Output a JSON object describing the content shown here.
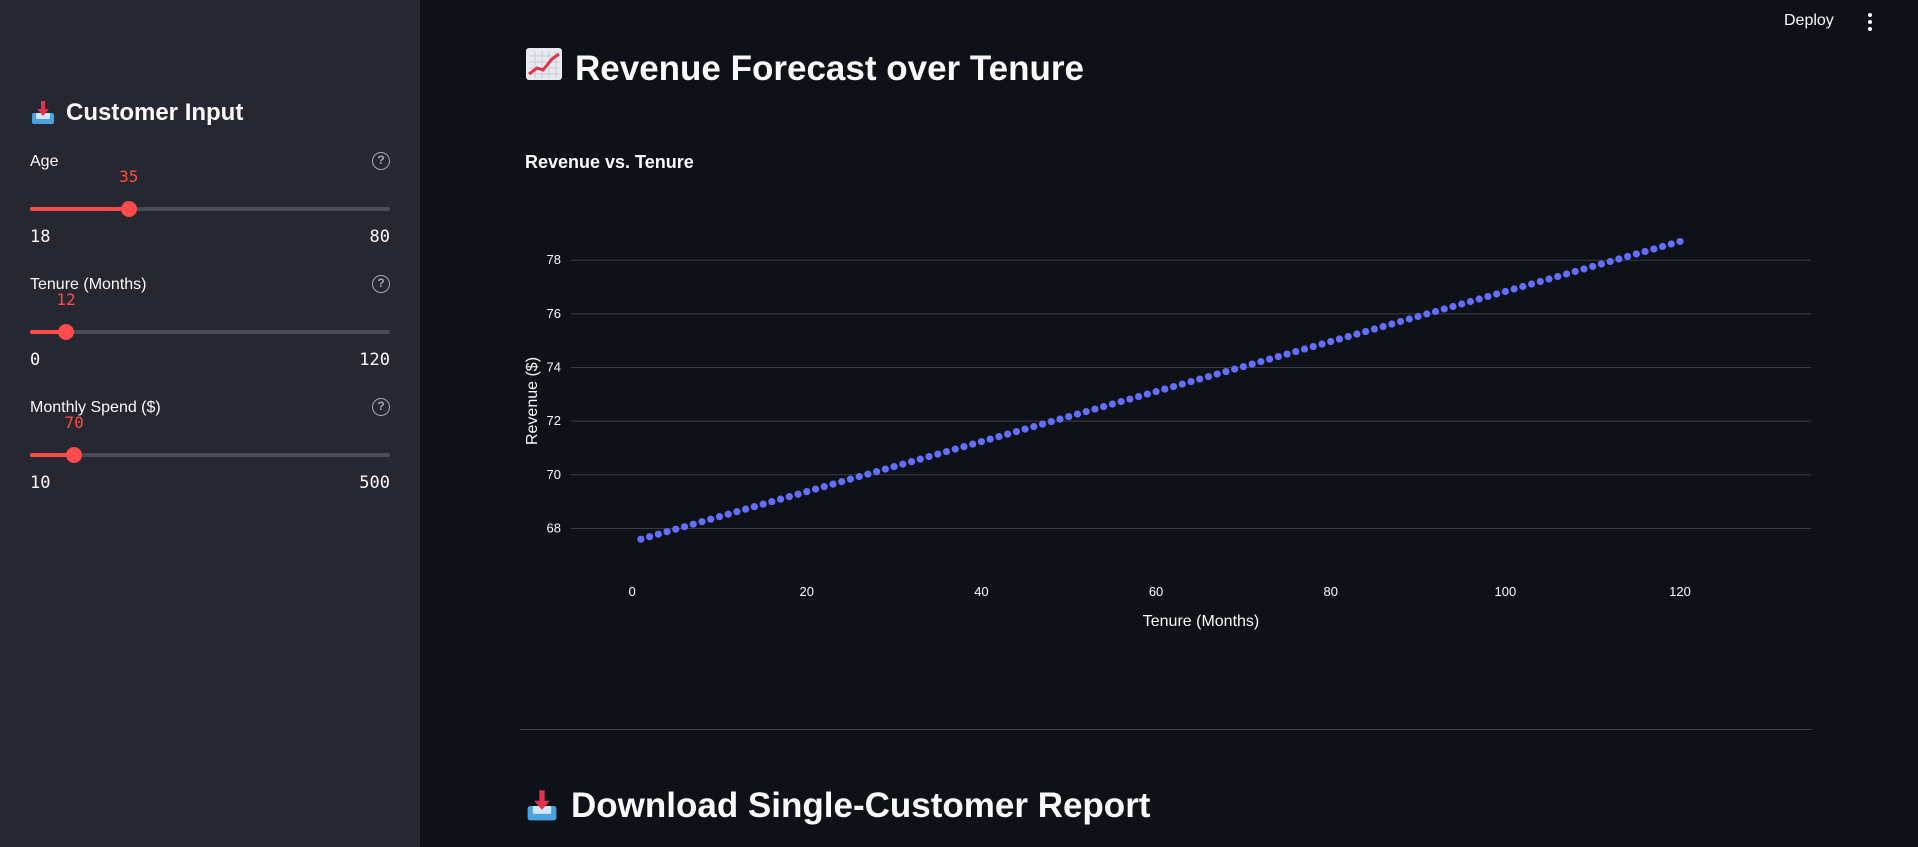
{
  "sidebar": {
    "title": "Customer Input",
    "sliders": [
      {
        "label": "Age",
        "value": 35,
        "min": 18,
        "max": 80
      },
      {
        "label": "Tenure (Months)",
        "value": 12,
        "min": 0,
        "max": 120
      },
      {
        "label": "Monthly Spend ($)",
        "value": 70,
        "min": 10,
        "max": 500
      }
    ]
  },
  "header": {
    "deploy_label": "Deploy",
    "menu_icon": "vertical-ellipsis-icon"
  },
  "main": {
    "forecast_heading": "Revenue Forecast over Tenure",
    "download_heading": "Download Single-Customer Report"
  },
  "colors": {
    "accent": "#ff4b4b",
    "series": "#636efa",
    "background": "#0e1117",
    "sidebar": "#262730"
  },
  "chart_data": {
    "type": "scatter",
    "title": "Revenue vs. Tenure",
    "xlabel": "Tenure (Months)",
    "ylabel": "Revenue ($)",
    "x_range": [
      1,
      120
    ],
    "y_range": [
      67.6,
      78.7
    ],
    "point_count": 120,
    "xticks": [
      0,
      20,
      40,
      60,
      80,
      100,
      120
    ],
    "yticks": [
      68,
      70,
      72,
      74,
      76,
      78
    ],
    "xlim": [
      -7,
      135
    ],
    "ylim": [
      66.6,
      79.5
    ],
    "grid": true,
    "series_color": "#636efa"
  }
}
